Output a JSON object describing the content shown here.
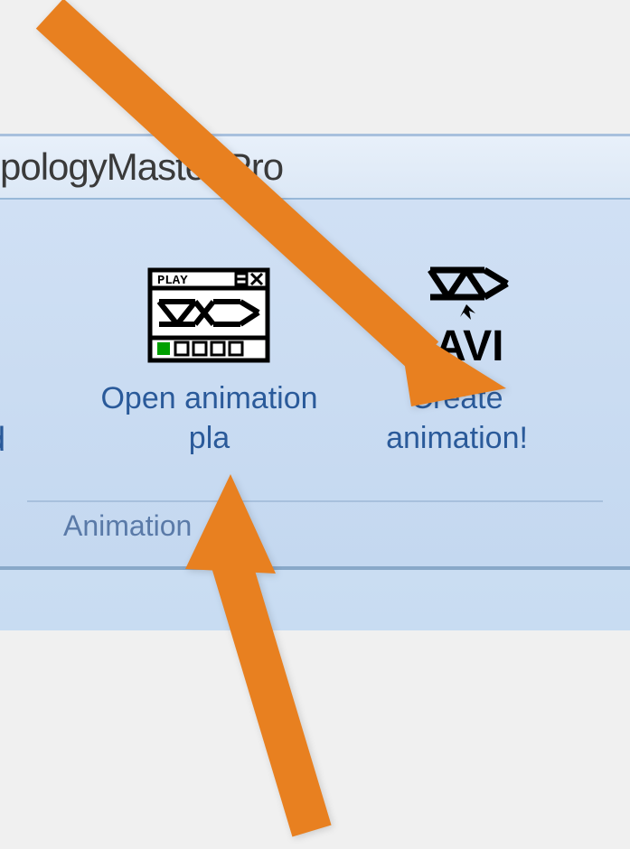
{
  "window": {
    "title": "pologyMaster Pro"
  },
  "ribbon": {
    "group_label": "Animation",
    "buttons": {
      "open_player": {
        "label": "Open animation\npla",
        "icon": "animation-player-icon"
      },
      "create_animation": {
        "label": "Create\nanimation!",
        "icon": "avi-export-icon"
      }
    }
  },
  "partial_text": "d",
  "annotation": {
    "arrow_color": "#e88020"
  }
}
